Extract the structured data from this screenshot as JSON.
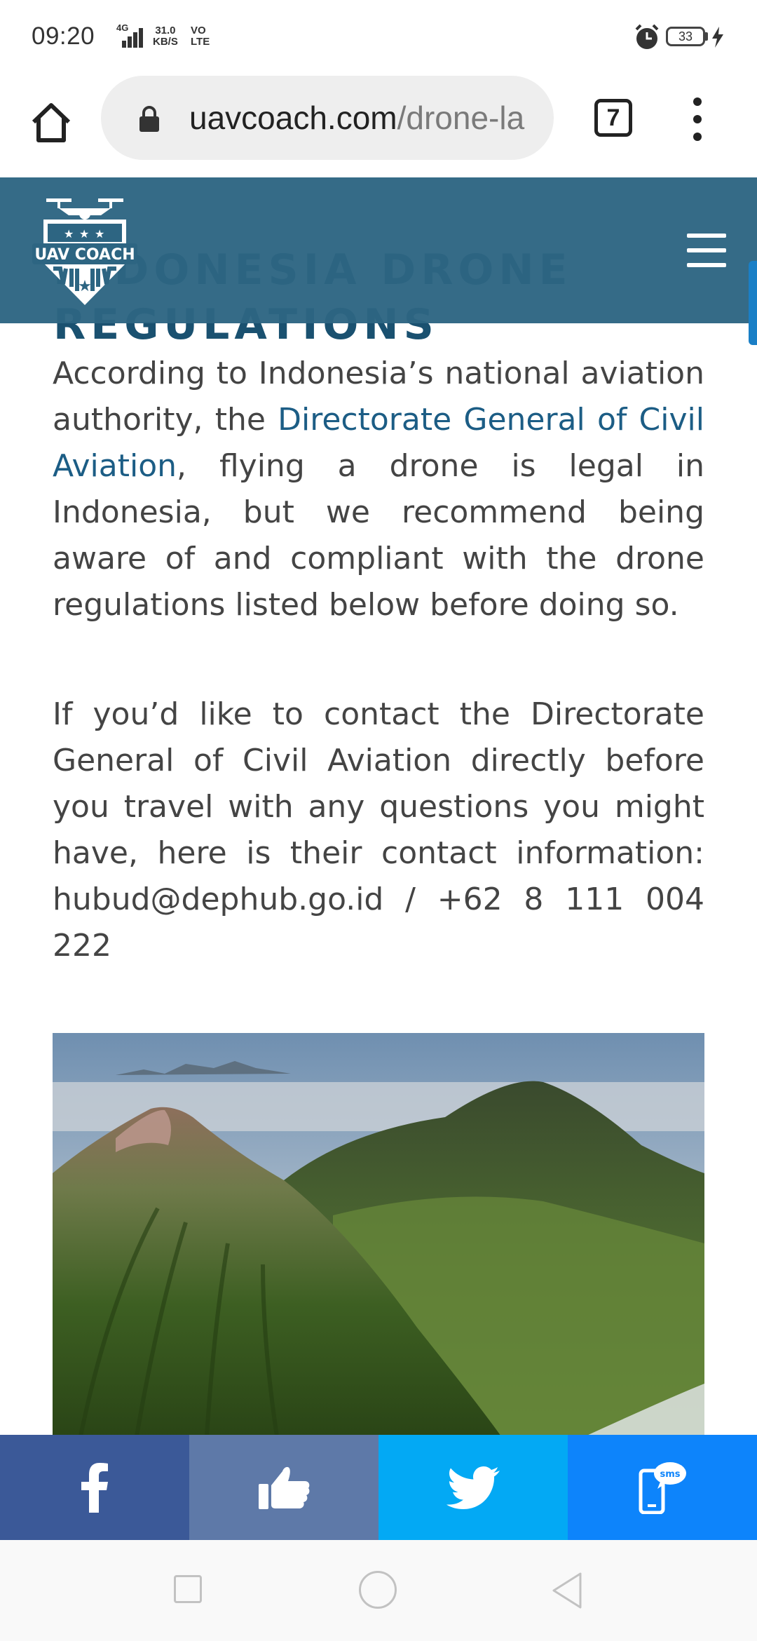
{
  "status_bar": {
    "time": "09:20",
    "network_type": "4G",
    "net_speed_value": "31.0",
    "net_speed_unit": "KB/S",
    "volte_line1": "VO",
    "volte_line2": "LTE",
    "battery_level": "33"
  },
  "browser": {
    "url_domain": "uavcoach.com",
    "url_path": "/drone-la",
    "tab_count": "7"
  },
  "site_header": {
    "logo_text": "UAV COACH"
  },
  "article": {
    "title": "Indonesia Drone Regulations",
    "paragraph1_before_link": "According to Indonesia’s national aviation authority, the ",
    "paragraph1_link": "Directorate General of Civil Aviation",
    "paragraph1_after_link": ", flying a drone is legal in Indonesia, but we recommend being aware of and compliant with the drone regulations listed below before doing so.",
    "paragraph2": "If you’d like to contact the Directorate General of Civil Aviation directly before you travel with any questions you might have, here is their contact information: hubud@dephub.go.id / +62 8 111 004 222"
  },
  "share_bar": {
    "sms_label": "sms"
  },
  "colors": {
    "header_bg": "#2d6582",
    "title_color": "#1a5170",
    "link_color": "#1c5d85",
    "facebook": "#3b5998",
    "like": "#5e79a8",
    "twitter": "#03a9f4",
    "sms": "#0d84fb"
  },
  "icons": {
    "status": [
      "signal-icon",
      "alarm-icon",
      "battery-icon",
      "charging-icon"
    ],
    "browser": [
      "home-icon",
      "lock-icon",
      "tabs-icon",
      "overflow-menu-icon"
    ],
    "site": [
      "hamburger-menu-icon"
    ],
    "share": [
      "facebook-icon",
      "thumbs-up-icon",
      "twitter-icon",
      "sms-icon"
    ],
    "nav": [
      "recent-apps-icon",
      "home-circle-icon",
      "back-triangle-icon"
    ]
  }
}
